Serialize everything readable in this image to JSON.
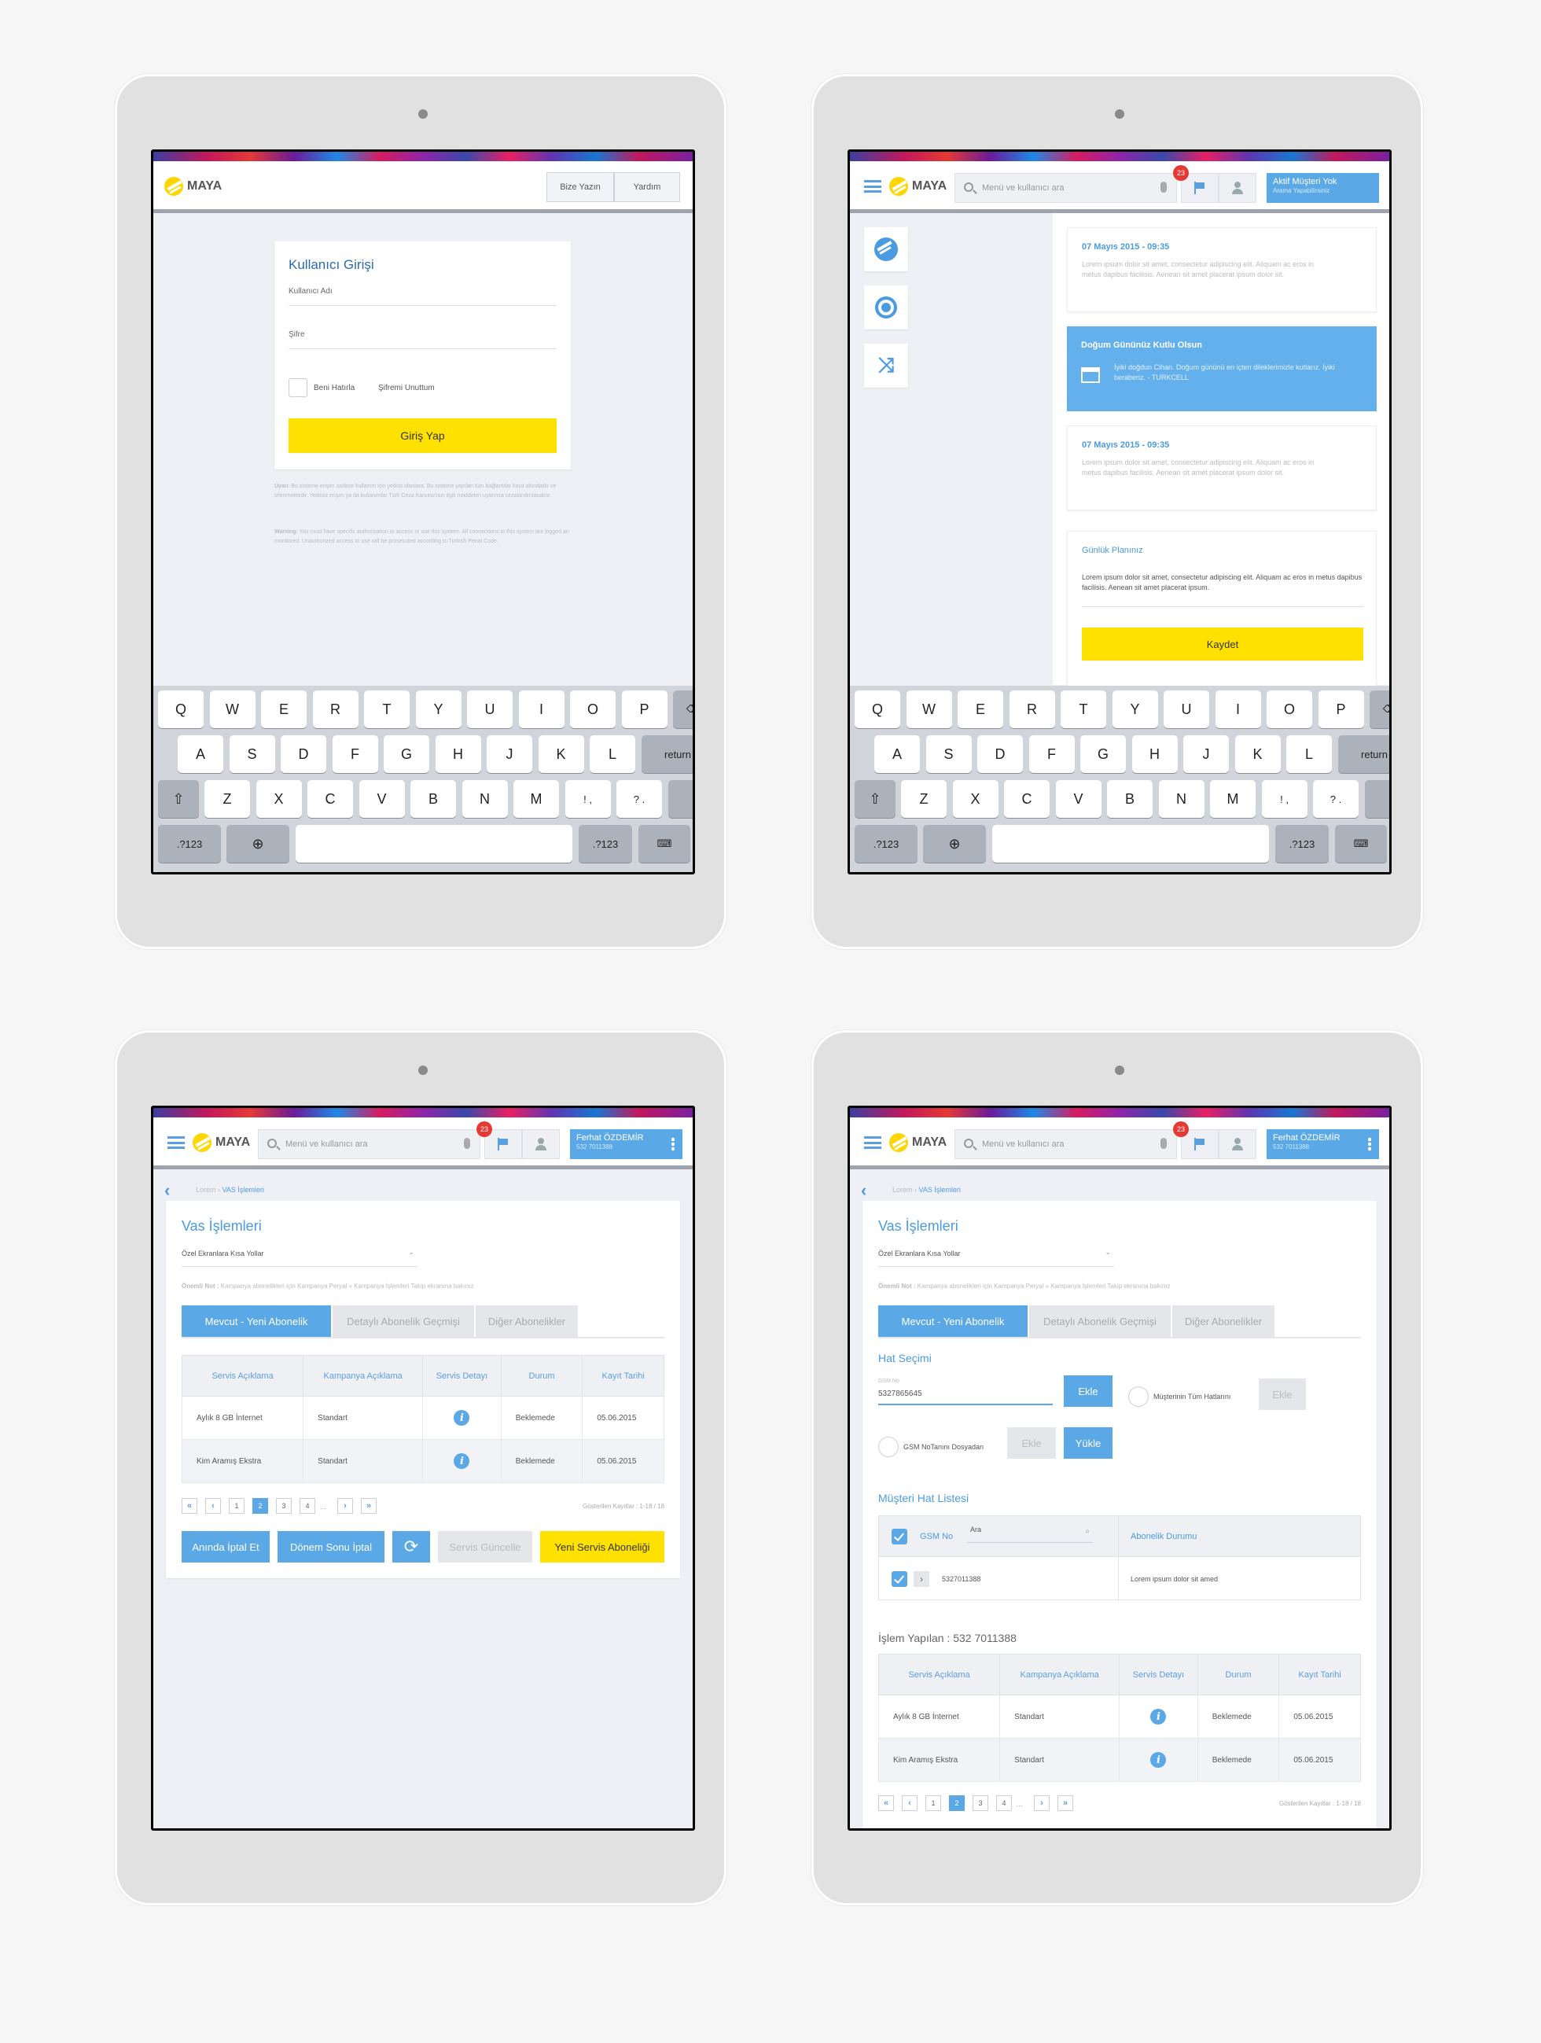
{
  "brand": {
    "name": "MAYA",
    "accent": "#5aa9e6",
    "yellow": "#ffe100"
  },
  "keyboard": {
    "row1": [
      "Q",
      "W",
      "E",
      "R",
      "T",
      "Y",
      "U",
      "I",
      "O",
      "P"
    ],
    "row2": [
      "A",
      "S",
      "D",
      "F",
      "G",
      "H",
      "J",
      "K",
      "L"
    ],
    "row3": [
      "Z",
      "X",
      "C",
      "V",
      "B",
      "N",
      "M"
    ],
    "return": "return",
    "numbers": ".?123",
    "punct1_top": "!",
    "punct1_bot": ",",
    "punct2_top": "?",
    "punct2_bot": "."
  },
  "header": {
    "search_placeholder": "Menü ve kullanıcı ara",
    "badge": "23"
  },
  "login": {
    "btn_write": "Bize Yazın",
    "btn_help": "Yardım",
    "title": "Kullanıcı Girişi",
    "username_label": "Kullanıcı Adı",
    "password_label": "Şifre",
    "remember": "Beni Hatırla",
    "forgot": "Şifremi Unuttum",
    "submit": "Giriş Yap",
    "notice1_bold": "Uyarı",
    "notice1": ": Bu sisteme erişim sadece kullanım için yetkisi olanlara. Bu sisteme yapılan tüm bağlantılar kayıt altındadır ve izlenmektedir. Yetkisiz erişim ya da kullanımlar Türk Ceza Kanunu'nun ilgili maddeleri uyarınca cezalandırılacaktır.",
    "notice2_bold": "Warning",
    "notice2": ": You must have specific authorization to access or use this system. All connections to this system are logged an monitored. Unauthorized access or use will be prosecuted according to Turkish Penal Code."
  },
  "dashboard": {
    "user_name": "Aktif Müşteri Yok",
    "user_sub": "Arama Yapabilirsiniz",
    "notes": [
      {
        "date": "07 Mayıs 2015 - 09:35",
        "text": "Lorem ipsum dolor sit amet, consectetur adipiscing elit. Aliquam ac eros in metus dapibus facilisis. Aenean sit amet placerat ipsum dolor sit."
      },
      {
        "date": "Doğum Gününüz Kutlu Olsun",
        "text": "İyiki doğdun Cihan. Doğum gününü en içten dileklerimizle kutlarız. İyiki beraberiz. - TURKCELL"
      },
      {
        "date": "07 Mayıs 2015 - 09:35",
        "text": "Lorem ipsum dolor sit amet, consectetur adipiscing elit. Aliquam ac eros in metus dapibus facilisis. Aenean sit amet placerat ipsum dolor sit."
      }
    ],
    "plan_title": "Günlük Planınız",
    "plan_text": "Lorem ipsum dolor sit amet, consectetur adipiscing elit. Aliquam ac eros in metus dapibus facilisis. Aenean sit amet placerat ipsum.",
    "save": "Kaydet"
  },
  "vas": {
    "user_name": "Ferhat ÖZDEMİR",
    "user_sub": "532 7011388",
    "crumb1": "Lorem",
    "crumb2": "VAS İşlemleri",
    "title": "Vas İşlemleri",
    "shortcut": "Özel Ekranlara Kısa Yollar",
    "note_bold": "Önemli Not :",
    "note": "Kampanya abonelikleri için Kampanya Peryal » Kampanya İşlemleri Takip ekranına bakınız",
    "tabs": [
      "Mevcut - Yeni Abonelik",
      "Detaylı Abonelik Geçmişi",
      "Diğer Abonelikler"
    ],
    "columns": [
      "Servis Açıklama",
      "Kampanya Açıklama",
      "Servis Detayı",
      "Durum",
      "Kayıt Tarihi"
    ],
    "rows": [
      [
        "Aylık 8 GB İnternet",
        "Standart",
        "i",
        "Beklemede",
        "05.06.2015"
      ],
      [
        "Kim Aramış Ekstra",
        "Standart",
        "i",
        "Beklemede",
        "05.06.2015"
      ]
    ],
    "pages": [
      "1",
      "2",
      "3",
      "4",
      "..."
    ],
    "records": "Gösterilen Kayıtlar : 1-18 / 18",
    "btn_cancel_now": "Anında İptal Et",
    "btn_cancel_term": "Dönem Sonu İptal",
    "btn_update": "Servis Güncelle",
    "btn_new": "Yeni Servis Aboneliği"
  },
  "line": {
    "section": "Hat Seçimi",
    "gsm_label": "GSM No",
    "gsm_value": "5327865645",
    "add": "Ekle",
    "all_lines": "Müşterinin Tüm Hatlarını",
    "file": "GSM NoTanını Dosyadan",
    "upload": "Yükle",
    "list_title": "Müşteri Hat Listesi",
    "col_gsm": "GSM No",
    "col_search": "Ara",
    "col_status": "Abonelik Durumu",
    "row_gsm": "5327011388",
    "row_status": "Lorem ipsum dolor sit amed",
    "done": "İşlem Yapılan : 532 7011388"
  }
}
